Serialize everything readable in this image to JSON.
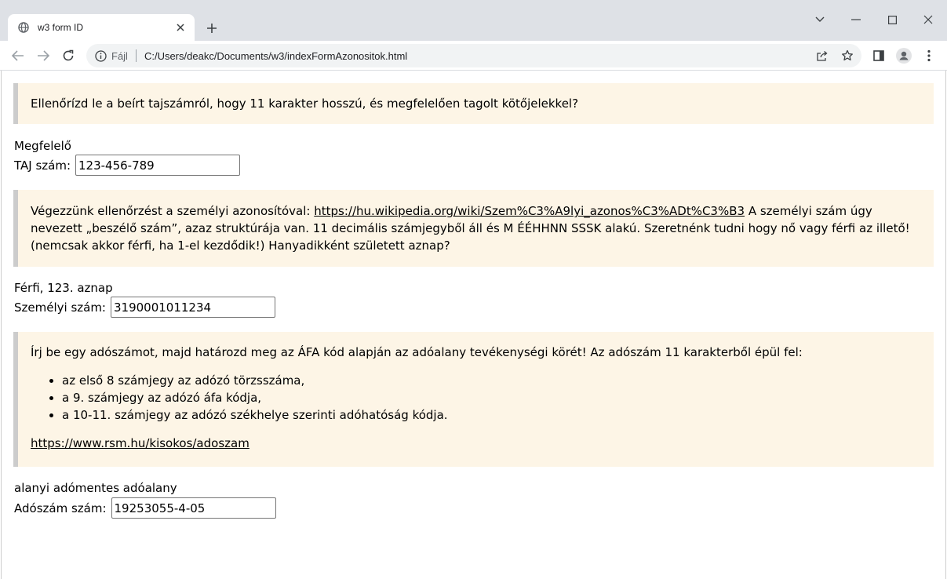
{
  "browser": {
    "tab_title": "w3 form ID",
    "address_scheme": "Fájl",
    "address_url": "C:/Users/deakc/Documents/w3/indexFormAzonositok.html"
  },
  "sections": [
    {
      "panel_text": "Ellenőrízd le a beírt tajszámról, hogy 11 karakter hosszú, és megfelelően tagolt kötőjelekkel?",
      "result": "Megfelelő",
      "label": "TAJ szám:",
      "value": "123-456-789"
    },
    {
      "panel_text_before_link": "Végezzünk ellenőrzést a személyi azonosítóval: ",
      "link": "https://hu.wikipedia.org/wiki/Szem%C3%A9lyi_azonos%C3%ADt%C3%B3",
      "panel_text_after_link": " A személyi szám úgy nevezett „beszélő szám”, azaz struktúrája van. 11 decimális számjegyből áll és M ÉÉHHNN SSSK alakú. Szeretnénk tudni hogy nő vagy férfi az illető! (nemcsak akkor férfi, ha 1-el kezdődik!) Hanyadikként született aznap?",
      "result": "Férfi, 123. aznap",
      "label": "Személyi szám:",
      "value": "3190001011234"
    },
    {
      "panel_intro": "Írj be egy adószámot, majd határozd meg az ÁFA kód alapján az adóalany tevékenységi körét! Az adószám 11 karakterből épül fel:",
      "panel_items": [
        "az első 8 számjegy az adózó törzsszáma,",
        "a 9. számjegy az adózó áfa kódja,",
        "a 10-11. számjegy az adózó székhelye szerinti adóhatóság kódja."
      ],
      "link": "https://www.rsm.hu/kisokos/adoszam",
      "result": "alanyi adómentes adóalany",
      "label": "Adószám szám:",
      "value": "19253055-4-05"
    }
  ]
}
